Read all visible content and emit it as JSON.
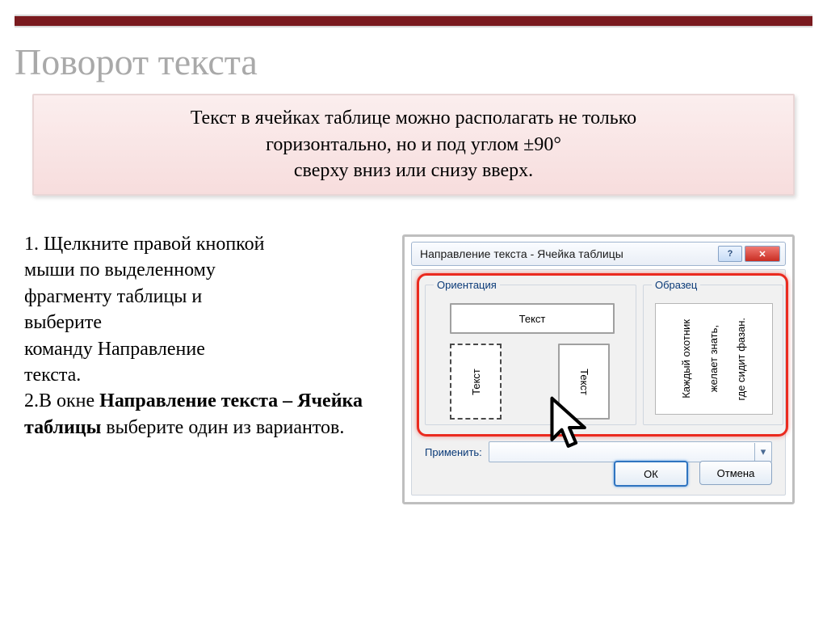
{
  "title": "Поворот текста",
  "callout": {
    "line1": "Текст в ячейках таблице можно располагать не только",
    "line2": "горизонтально, но и под углом ±90°",
    "line3": "сверху вниз или снизу вверх."
  },
  "body": {
    "step1_a": "1. Щелкните правой кнопкой",
    "step1_b": "мыши по выделенному",
    "step1_c": "фрагменту таблицы и",
    "step1_d": "выберите",
    "step1_e": "команду Направление",
    "step1_f": "текста.",
    "step2_a": "2.В окне ",
    "step2_bold": "Направление текста – Ячейка таблицы",
    "step2_b": " выберите один из вариантов."
  },
  "dialog": {
    "title": "Направление текста - Ячейка таблицы",
    "help_symbol": "?",
    "close_symbol": "✕",
    "group_orientation": "Ориентация",
    "group_sample": "Образец",
    "btn_text": "Текст",
    "sample_line1": "Каждый охотник",
    "sample_line2": "желает знать,",
    "sample_line3": "где сидит фазан.",
    "apply_label": "Применить:",
    "ok": "ОК",
    "cancel": "Отмена"
  }
}
